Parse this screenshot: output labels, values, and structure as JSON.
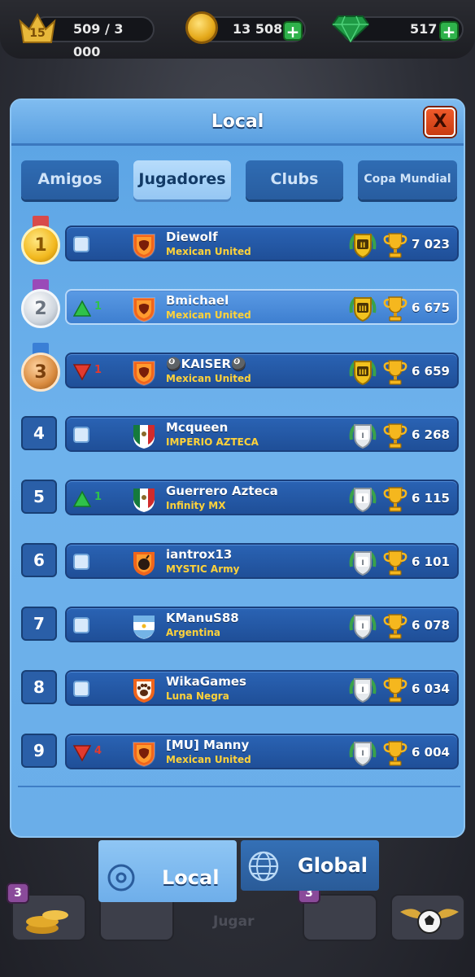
{
  "hud": {
    "level": "15",
    "xp": "509 / 3 000",
    "coins": "13 508",
    "gems": "517",
    "plus": "+"
  },
  "modal": {
    "title": "Local",
    "close": "X"
  },
  "tabs": [
    {
      "label": "Amigos",
      "active": false
    },
    {
      "label": "Jugadores",
      "active": true
    },
    {
      "label": "Clubs",
      "active": false
    },
    {
      "label": "Copa Mundial",
      "active": false
    }
  ],
  "rows": [
    {
      "rank": "1",
      "medal": "gold",
      "change_type": "same",
      "change": "",
      "crest": "club-orange",
      "name": "Diewolf",
      "club": "Mexican United",
      "league": "II",
      "league_tier": "gold",
      "trophies": "7 023",
      "highlight": false
    },
    {
      "rank": "2",
      "medal": "silver",
      "change_type": "up",
      "change": "1",
      "crest": "club-orange",
      "name": "Bmichael",
      "club": "Mexican United",
      "league": "III",
      "league_tier": "gold",
      "trophies": "6 675",
      "highlight": true
    },
    {
      "rank": "3",
      "medal": "bronze",
      "change_type": "down",
      "change": "1",
      "crest": "club-orange",
      "name": "🎱KAISER🎱",
      "club": "Mexican United",
      "league": "III",
      "league_tier": "gold",
      "trophies": "6 659",
      "highlight": false
    },
    {
      "rank": "4",
      "medal": "",
      "change_type": "same",
      "change": "",
      "crest": "flag-mexico",
      "name": "Mcqueen",
      "club": "IMPERIO AZTECA",
      "league": "I",
      "league_tier": "silver",
      "trophies": "6 268",
      "highlight": false
    },
    {
      "rank": "5",
      "medal": "",
      "change_type": "up",
      "change": "1",
      "crest": "flag-mexico",
      "name": "Guerrero Azteca",
      "club": "Infinity MX",
      "league": "I",
      "league_tier": "silver",
      "trophies": "6 115",
      "highlight": false
    },
    {
      "rank": "6",
      "medal": "",
      "change_type": "same",
      "change": "",
      "crest": "club-bomb",
      "name": "iantrox13",
      "club": "MYSTIC Army",
      "league": "I",
      "league_tier": "silver",
      "trophies": "6 101",
      "highlight": false
    },
    {
      "rank": "7",
      "medal": "",
      "change_type": "same",
      "change": "",
      "crest": "flag-argentina",
      "name": "KManuS88",
      "club": "Argentina",
      "league": "I",
      "league_tier": "silver",
      "trophies": "6 078",
      "highlight": false
    },
    {
      "rank": "8",
      "medal": "",
      "change_type": "same",
      "change": "",
      "crest": "club-paw",
      "name": "WikaGames",
      "club": "Luna Negra",
      "league": "I",
      "league_tier": "silver",
      "trophies": "6 034",
      "highlight": false
    },
    {
      "rank": "9",
      "medal": "",
      "change_type": "down",
      "change": "4",
      "crest": "club-orange",
      "name": "[MU] Manny",
      "club": "Mexican United",
      "league": "I",
      "league_tier": "silver",
      "trophies": "6 004",
      "highlight": false
    }
  ],
  "scope": {
    "local": "Local",
    "global": "Global"
  },
  "bottom": {
    "jugar": "Jugar",
    "badge_left": "3",
    "badge_right": "3"
  },
  "colors": {
    "up": "#2fc24a",
    "down": "#e23a2f",
    "club_name": "#ffd23a"
  }
}
